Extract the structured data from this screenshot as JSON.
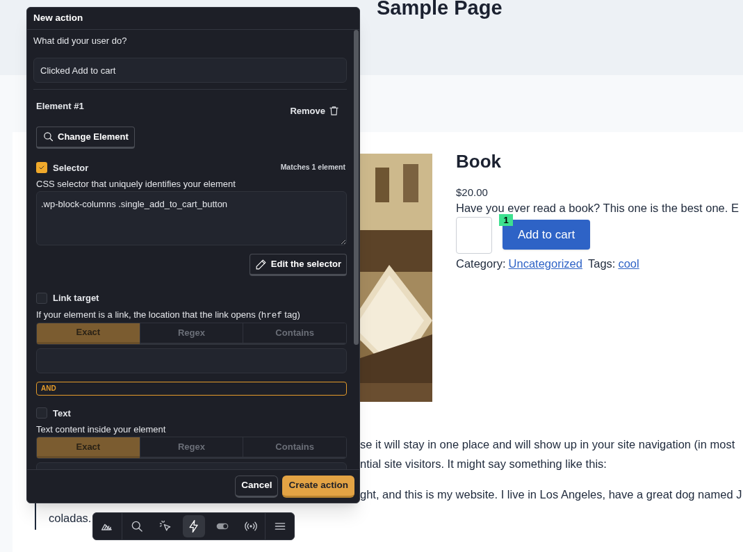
{
  "page": {
    "title": "Sample Page",
    "product": {
      "name": "Book",
      "price": "$20.00",
      "description": "Have you ever read a book? This one is the best one. E",
      "badge": "1",
      "button": "Add to cart",
      "category_label": "Category:",
      "category": "Uncategorized",
      "tags_label": "Tags:",
      "tag": "cool"
    },
    "paragraph_lines": [
      "se it will stay in one place and will show up in your site navigation (in most",
      "ntial site visitors. It might say something like this:"
    ],
    "quote_lines": [
      "ght, and this is my website. I live in Los Angeles, have a great dog named J",
      "coladas."
    ]
  },
  "panel": {
    "title": "New action",
    "question": "What did your user do?",
    "action_name": "Clicked Add to cart",
    "element_title": "Element #1",
    "remove": "Remove",
    "change_element": "Change Element",
    "filters": [
      {
        "kind": "selector",
        "label": "Selector",
        "checked": true,
        "matches": "Matches 1 element",
        "description": "CSS selector that uniquely identifies your element",
        "value": ".wp-block-columns .single_add_to_cart_button",
        "edit_button": "Edit the selector"
      },
      {
        "kind": "match",
        "label": "Link target",
        "checked": false,
        "description": "If your element is a link, the location that the link opens (",
        "code": "href",
        "description_end": " tag)",
        "modes": [
          {
            "label": "Exact",
            "selected": true
          },
          {
            "label": "Regex",
            "selected": false
          },
          {
            "label": "Contains",
            "selected": false
          }
        ]
      },
      {
        "kind": "connector",
        "label": "AND"
      },
      {
        "kind": "match",
        "label": "Text",
        "checked": false,
        "description": "Text content inside your element",
        "modes": [
          {
            "label": "Exact",
            "selected": true
          },
          {
            "label": "Regex",
            "selected": false
          },
          {
            "label": "Contains",
            "selected": false
          }
        ]
      }
    ],
    "cancel": "Cancel",
    "create": "Create action"
  },
  "toolbar": {
    "items": [
      {
        "kind": "logo",
        "selected": false
      },
      {
        "kind": "search",
        "selected": false
      },
      {
        "kind": "inspect",
        "selected": false
      },
      {
        "kind": "actions",
        "selected": true
      },
      {
        "kind": "toggle",
        "selected": false
      },
      {
        "kind": "live",
        "selected": false
      },
      {
        "kind": "menu",
        "selected": false
      }
    ]
  }
}
